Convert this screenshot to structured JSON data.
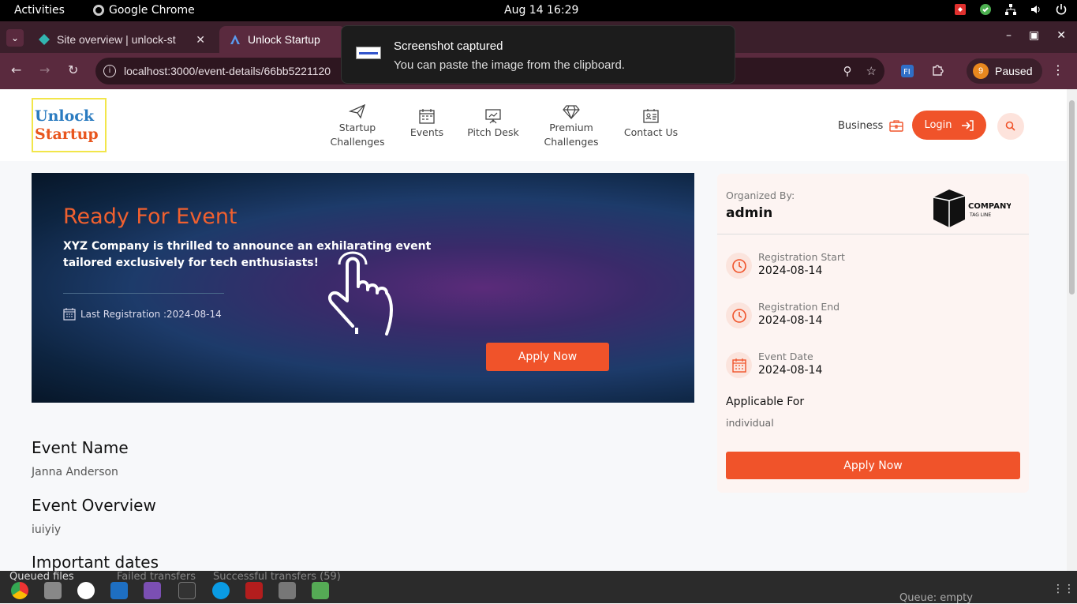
{
  "system": {
    "activities": "Activities",
    "app_name": "Google Chrome",
    "clock": "Aug 14  16:29"
  },
  "browser": {
    "tabs": [
      {
        "title": "Site overview | unlock-st"
      },
      {
        "title": "Unlock Startup"
      }
    ],
    "url": "localhost:3000/event-details/66bb5221120",
    "profile_badge": "9",
    "profile_status": "Paused"
  },
  "notification": {
    "title": "Screenshot captured",
    "body": "You can paste the image from the clipboard."
  },
  "site": {
    "logo_line1": "Unlock",
    "logo_line2": "Startup",
    "nav": [
      {
        "label1": "Startup",
        "label2": "Challenges",
        "icon": "paper-plane-icon"
      },
      {
        "label1": "Events",
        "label2": "",
        "icon": "calendar-icon"
      },
      {
        "label1": "Pitch Desk",
        "label2": "",
        "icon": "presentation-board-icon"
      },
      {
        "label1": "Premium",
        "label2": "Challenges",
        "icon": "diamond-icon"
      },
      {
        "label1": "Contact Us",
        "label2": "",
        "icon": "contact-card-icon"
      }
    ],
    "business": "Business",
    "login": "Login",
    "accent": "#f0532a"
  },
  "banner": {
    "title": "Ready For Event",
    "description": "XYZ Company is thrilled to announce an exhilarating event tailored exclusively for tech enthusiasts!",
    "last_registration_label": "Last Registration :",
    "last_registration_date": "2024-08-14",
    "apply": "Apply Now"
  },
  "details": {
    "event_name_heading": "Event Name",
    "event_name": "Janna Anderson",
    "overview_heading": "Event Overview",
    "overview": "iuiyiy",
    "dates_heading": "Important dates"
  },
  "sidebar": {
    "organized_by_label": "Organized By:",
    "organizer": "admin",
    "company_logo_line1": "COMPANY",
    "company_logo_line2": "TAG LINE",
    "dates": [
      {
        "label": "Registration Start",
        "value": "2024-08-14",
        "icon": "clock-icon"
      },
      {
        "label": "Registration End",
        "value": "2024-08-14",
        "icon": "clock-icon"
      },
      {
        "label": "Event Date",
        "value": "2024-08-14",
        "icon": "calendar-icon"
      }
    ],
    "applicable_for_label": "Applicable For",
    "applicable_for_value": "individual",
    "apply": "Apply Now"
  },
  "dock": {
    "queued_files": "Queued files",
    "failed_transfers": "Failed transfers",
    "successful_transfers": "Successful transfers (59)",
    "queue_status": "Queue: empty"
  }
}
